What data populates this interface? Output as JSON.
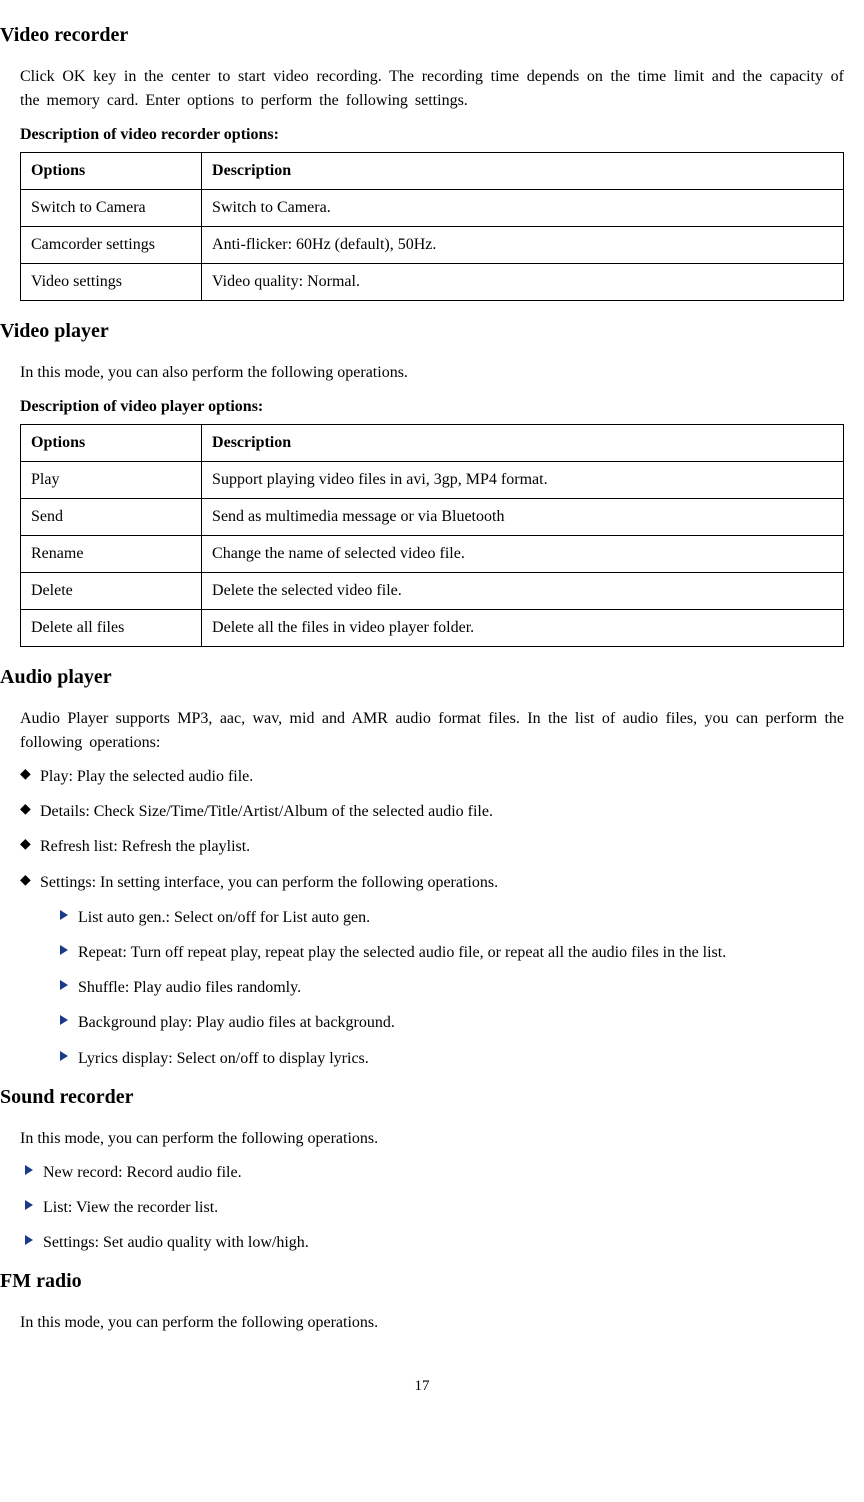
{
  "video_recorder": {
    "heading": "Video recorder",
    "intro": "Click OK key in the center to start video recording. The recording time depends on the time limit and the capacity of the memory card. Enter options to perform the following settings.",
    "desc_label": "Description of video recorder options:",
    "table": {
      "headers": [
        "Options",
        "Description"
      ],
      "rows": [
        [
          "Switch to Camera",
          "Switch to Camera."
        ],
        [
          "Camcorder settings",
          "Anti-flicker: 60Hz (default), 50Hz."
        ],
        [
          "Video settings",
          "Video quality: Normal."
        ]
      ]
    }
  },
  "video_player": {
    "heading": "Video player",
    "intro": "In this mode, you can also perform the following operations.",
    "desc_label": "Description of video player options:",
    "table": {
      "headers": [
        "Options",
        "Description"
      ],
      "rows": [
        [
          "Play",
          "Support playing video files in avi, 3gp, MP4 format."
        ],
        [
          "Send",
          "Send as multimedia message or via Bluetooth"
        ],
        [
          "Rename",
          "Change the name of selected video file."
        ],
        [
          "Delete",
          "Delete the selected video file."
        ],
        [
          "Delete all files",
          "Delete all the files in video player folder."
        ]
      ]
    }
  },
  "audio_player": {
    "heading": "Audio player",
    "intro": "Audio Player supports MP3, aac, wav, mid and AMR audio format files. In the list of audio files, you can perform the following operations:",
    "bullets": [
      "Play: Play the selected audio file.",
      "Details: Check Size/Time/Title/Artist/Album of the selected audio file.",
      "Refresh list: Refresh the playlist.",
      "Settings: In setting interface, you can perform the following operations."
    ],
    "sub_bullets": [
      "List auto gen.: Select on/off for List auto gen.",
      "Repeat: Turn off repeat play, repeat play the selected audio file, or repeat all the audio files in the list.",
      "Shuffle: Play audio files randomly.",
      "Background play: Play audio files at background.",
      "Lyrics display: Select on/off to display lyrics."
    ]
  },
  "sound_recorder": {
    "heading": "Sound recorder",
    "intro": "In this mode, you can perform the following operations.",
    "bullets": [
      "New record: Record audio file.",
      "List: View the recorder list.",
      "Settings: Set audio quality with low/high."
    ]
  },
  "fm_radio": {
    "heading": "FM radio",
    "intro": "In this mode, you can perform the following operations."
  },
  "page_number": "17"
}
